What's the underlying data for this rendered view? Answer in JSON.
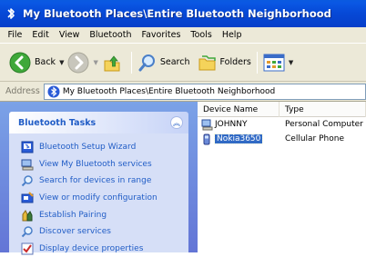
{
  "window": {
    "title": "My Bluetooth Places\\Entire Bluetooth Neighborhood"
  },
  "menubar": {
    "items": [
      "File",
      "Edit",
      "View",
      "Bluetooth",
      "Favorites",
      "Tools",
      "Help"
    ]
  },
  "toolbar": {
    "back_label": "Back",
    "search_label": "Search",
    "folders_label": "Folders"
  },
  "address": {
    "label": "Address",
    "value": "My Bluetooth Places\\Entire Bluetooth Neighborhood"
  },
  "taskpane": {
    "title": "Bluetooth Tasks",
    "items": [
      {
        "label": "Bluetooth Setup Wizard",
        "icon": "wizard-icon"
      },
      {
        "label": "View My Bluetooth services",
        "icon": "computer-icon"
      },
      {
        "label": "Search for devices in range",
        "icon": "search-icon"
      },
      {
        "label": "View or modify configuration",
        "icon": "configuration-icon"
      },
      {
        "label": "Establish Pairing",
        "icon": "pairing-icon"
      },
      {
        "label": "Discover services",
        "icon": "search-icon"
      },
      {
        "label": "Display device properties",
        "icon": "properties-icon"
      }
    ]
  },
  "listview": {
    "columns": [
      "Device Name",
      "Type"
    ],
    "rows": [
      {
        "name": "JOHNNY",
        "type": "Personal Computer",
        "icon": "computer-icon",
        "selected": false
      },
      {
        "name": "Nokia3650",
        "type": "Cellular Phone",
        "icon": "phone-icon",
        "selected": true
      }
    ]
  },
  "colors": {
    "titlebar": "#0648d6",
    "taskpane_bg": "#6375d6",
    "task_link": "#215dc6",
    "selection": "#316ac5"
  }
}
